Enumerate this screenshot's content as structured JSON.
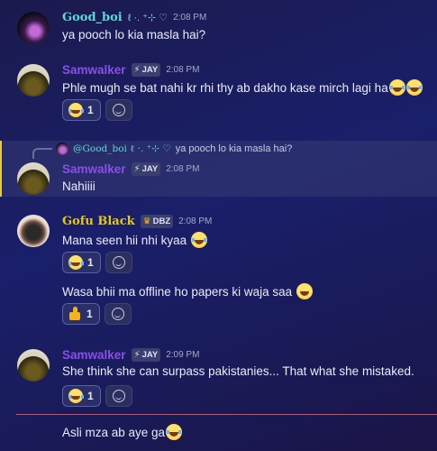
{
  "messages": [
    {
      "user": "Good_boi",
      "user_suffix": "ℓ ·. ⁺⊹ ♡",
      "time": "2:08 PM",
      "text": "ya pooch lo kia masla hai?"
    },
    {
      "user": "Samwalker",
      "tag": "JAY",
      "time": "2:08 PM",
      "text": "Phle mugh se bat nahi kr rhi thy ab dakho kase mirch lagi ha",
      "reaction_count": "1"
    },
    {
      "reply_user": "@Good_boi ℓ ·. ⁺⊹ ♡",
      "reply_text": "ya pooch lo kia masla hai?",
      "user": "Samwalker",
      "tag": "JAY",
      "time": "2:08 PM",
      "text": "Nahiiii"
    },
    {
      "user": "Gofu Black",
      "tag": "DBZ",
      "time": "2:08 PM",
      "text": "Mana seen hii nhi kyaa",
      "reaction_count": "1"
    },
    {
      "text": "Wasa bhii ma offline ho papers ki waja saa",
      "reaction_count": "1"
    },
    {
      "user": "Samwalker",
      "tag": "JAY",
      "time": "2:09 PM",
      "text": "She think she can surpass pakistanies... That what she mistaked.",
      "reaction_count": "1"
    },
    {
      "text": "Asli mza ab aye ga"
    }
  ],
  "icons": {
    "tag_icon_jay": "lightning-icon",
    "tag_icon_dbz": "crest-icon",
    "add_reaction": "add-reaction-icon"
  },
  "colors": {
    "good_boi": "#5fd6d6",
    "samwalker": "#8a4fe6",
    "gofu_black": "#e3c91a",
    "new_divider": "#e04a55"
  }
}
